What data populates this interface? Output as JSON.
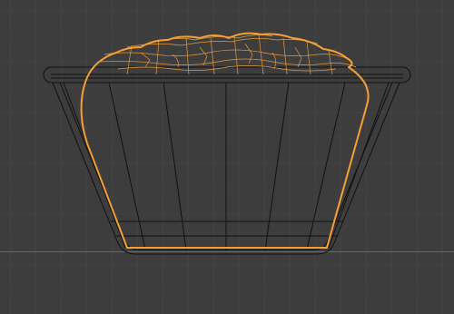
{
  "viewport": {
    "view": "front-orthographic",
    "background_color": "#3d3d3d",
    "grid": {
      "minor_color": "#444444",
      "major_color": "#4a4a4a",
      "x_axis_color": "#b34a4a"
    }
  },
  "scene": {
    "objects": [
      {
        "name": "pot",
        "selected": false,
        "wire_color": "#111111"
      },
      {
        "name": "soil",
        "selected": true,
        "outline_color": "#f5a033",
        "wire_color": "#e89a3a"
      }
    ]
  }
}
